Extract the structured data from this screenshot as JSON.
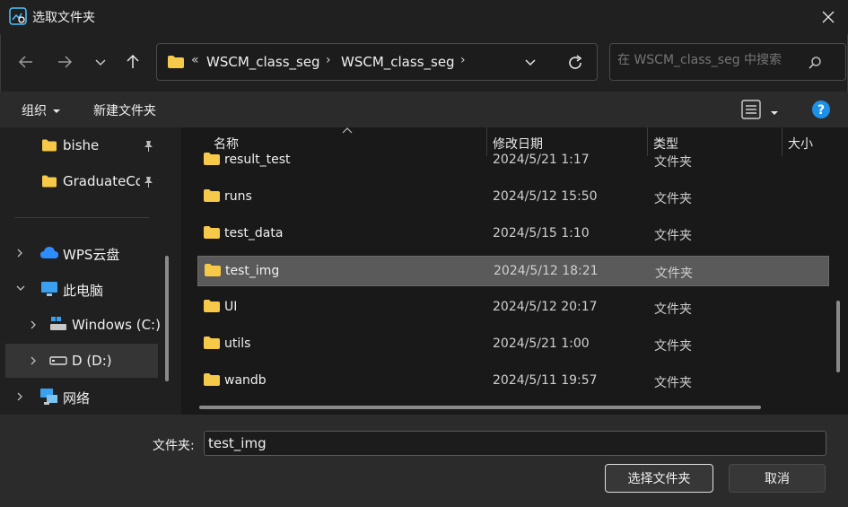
{
  "window": {
    "title": "选取文件夹"
  },
  "address": {
    "overflow": "«",
    "crumbs": [
      "WSCM_class_seg",
      "WSCM_class_seg"
    ]
  },
  "search": {
    "placeholder": "在 WSCM_class_seg 中搜索"
  },
  "toolbar": {
    "organize": "组织",
    "new_folder": "新建文件夹"
  },
  "sidebar": {
    "items": [
      {
        "label": "bishe",
        "icon": "folder-icon",
        "pinned": true
      },
      {
        "label": "GraduateCo",
        "icon": "folder-icon",
        "pinned": true
      },
      {
        "label": "WPS云盘",
        "icon": "cloud-icon"
      },
      {
        "label": "此电脑",
        "icon": "computer-icon"
      },
      {
        "label": "Windows (C:)",
        "icon": "drive-icon"
      },
      {
        "label": "D (D:)",
        "icon": "drive-icon",
        "selected": true
      },
      {
        "label": "网络",
        "icon": "network-icon"
      }
    ]
  },
  "columns": {
    "name": "名称",
    "date": "修改日期",
    "type": "类型",
    "size": "大小"
  },
  "files": [
    {
      "name": "result_test",
      "date": "2024/5/21 1:17",
      "type": "文件夹"
    },
    {
      "name": "runs",
      "date": "2024/5/12 15:50",
      "type": "文件夹"
    },
    {
      "name": "test_data",
      "date": "2024/5/15 1:10",
      "type": "文件夹"
    },
    {
      "name": "test_img",
      "date": "2024/5/12 18:21",
      "type": "文件夹",
      "selected": true
    },
    {
      "name": "UI",
      "date": "2024/5/12 20:17",
      "type": "文件夹"
    },
    {
      "name": "utils",
      "date": "2024/5/21 1:00",
      "type": "文件夹"
    },
    {
      "name": "wandb",
      "date": "2024/5/11 19:57",
      "type": "文件夹"
    }
  ],
  "footer": {
    "folder_label": "文件夹:",
    "folder_value": "test_img",
    "select_button": "选择文件夹",
    "cancel_button": "取消"
  },
  "colors": {
    "folder": "#f7c948",
    "accent": "#4cc2ff",
    "selected_row": "#5a5a5a"
  }
}
